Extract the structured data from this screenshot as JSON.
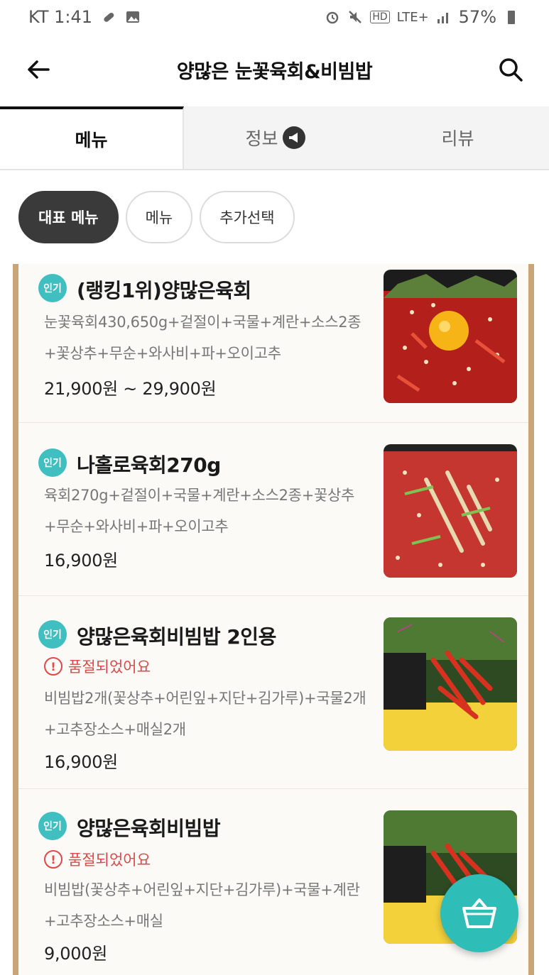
{
  "status_bar": {
    "carrier_time": "KT 1:41",
    "network": "LTE+",
    "battery": "57%"
  },
  "header": {
    "title": "양많은 눈꽃육회&비빔밥"
  },
  "tabs": [
    {
      "label": "메뉴",
      "active": true
    },
    {
      "label": "정보",
      "active": false
    },
    {
      "label": "리뷰",
      "active": false
    }
  ],
  "chips": [
    {
      "label": "대표 메뉴",
      "active": true
    },
    {
      "label": "메뉴",
      "active": false
    },
    {
      "label": "추가선택",
      "active": false
    }
  ],
  "menu_items": [
    {
      "badge": "인기",
      "name": "(랭킹1위)양많은육회",
      "soldout": "",
      "description": "눈꽃육회430,650g+겉절이+국물+계란+소스2종+꽃상추+무순+와사비+파+오이고추",
      "price": "21,900원 ~ 29,900원"
    },
    {
      "badge": "인기",
      "name": "나홀로육회270g",
      "soldout": "",
      "description": "육회270g+겉절이+국물+계란+소스2종+꽃상추+무순+와사비+파+오이고추",
      "price": "16,900원"
    },
    {
      "badge": "인기",
      "name": "양많은육회비빔밥 2인용",
      "soldout": "품절되었어요",
      "description": "비빔밥2개(꽃상추+어린잎+지단+김가루)+국물2개+고추장소스+매실2개",
      "price": "16,900원"
    },
    {
      "badge": "인기",
      "name": "양많은육회비빔밥",
      "soldout": "품절되었어요",
      "description": "비빔밥(꽃상추+어린잎+지단+김가루)+국물+계란+고추장소스+매실",
      "price": "9,000원"
    }
  ],
  "colors": {
    "accent": "#2fbdb7",
    "badge": "#3fbfbf",
    "soldout": "#e24848",
    "frame": "#c9a578"
  },
  "icons": {
    "back": "arrow-left-icon",
    "search": "search-icon",
    "info_badge": "megaphone-icon",
    "cart": "basket-icon"
  }
}
